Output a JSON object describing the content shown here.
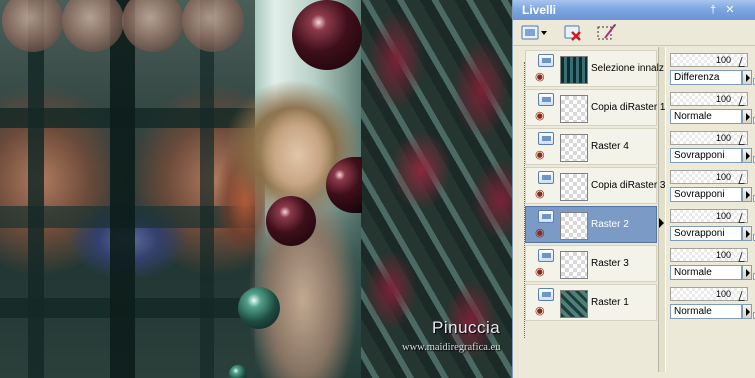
{
  "canvas": {
    "watermark_name": "Pinuccia",
    "watermark_url": "www.maidiregrafica.eu"
  },
  "palette": {
    "title": "Livelli",
    "title_buttons": {
      "pin": "†",
      "close": "✕"
    },
    "toolbar": {
      "new_layer_icon": "new-raster-layer-icon",
      "delete_layer_icon": "delete-layer-icon",
      "edit_selection_icon": "edit-selection-icon"
    },
    "layers": [
      {
        "name": "Selezione innalz",
        "opacity": "100",
        "blend": "Differenza",
        "selected": false
      },
      {
        "name": "Copia diRaster 1",
        "opacity": "100",
        "blend": "Normale",
        "selected": false
      },
      {
        "name": "Raster 4",
        "opacity": "100",
        "blend": "Sovrapponi",
        "selected": false
      },
      {
        "name": "Copia diRaster 3",
        "opacity": "100",
        "blend": "Sovrapponi",
        "selected": false
      },
      {
        "name": "Raster 2",
        "opacity": "100",
        "blend": "Sovrapponi",
        "selected": true
      },
      {
        "name": "Raster 3",
        "opacity": "100",
        "blend": "Normale",
        "selected": false
      },
      {
        "name": "Raster 1",
        "opacity": "100",
        "blend": "Normale",
        "selected": false
      }
    ]
  }
}
